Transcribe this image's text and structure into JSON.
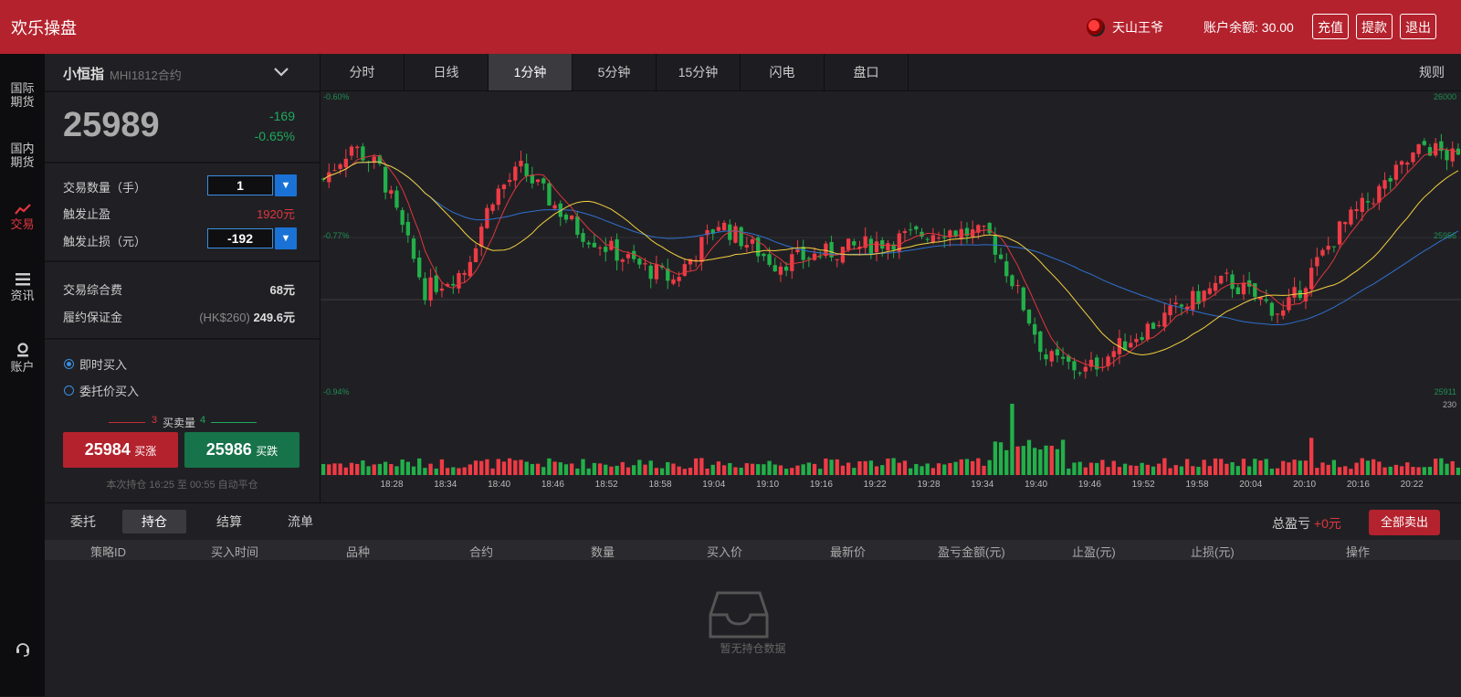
{
  "app": {
    "title": "欢乐操盘"
  },
  "header": {
    "username": "天山王爷",
    "balance_label": "账户余额:",
    "balance_value": "30.00",
    "buttons": {
      "recharge": "充值",
      "withdraw": "提款",
      "logout": "退出"
    }
  },
  "nav": {
    "items": [
      {
        "label_line1": "国际",
        "label_line2": "期货",
        "icon": "globe-icon"
      },
      {
        "label_line1": "国内",
        "label_line2": "期货",
        "icon": "flag-icon"
      },
      {
        "label": "交易",
        "icon": "trend-icon",
        "active": true
      },
      {
        "label": "资讯",
        "icon": "list-icon"
      },
      {
        "label": "账户",
        "icon": "user-icon"
      }
    ],
    "support_icon": "headset-icon"
  },
  "instrument": {
    "name": "小恒指",
    "contract": "MHI1812合约",
    "price": "25989",
    "change": "-169",
    "change_pct": "-0.65%"
  },
  "order": {
    "qty_label": "交易数量（手）",
    "qty_value": "1",
    "take_profit_label": "触发止盈",
    "take_profit_value": "1920元",
    "stop_loss_label": "触发止损（元）",
    "stop_loss_value": "-192",
    "fee_label": "交易综合费",
    "fee_value": "68元",
    "margin_label": "履约保证金",
    "margin_hk": "(HK$260)",
    "margin_value": "249.6元",
    "radio_instant": "即时买入",
    "radio_limit": "委托价买入",
    "depth_left": "3",
    "depth_label": "买卖量",
    "depth_right": "4",
    "buy_up_price": "25984",
    "buy_up_label": "买涨",
    "buy_down_price": "25986",
    "buy_down_label": "买跌",
    "hold_note": "本次持仓 16:25 至 00:55 自动平仓"
  },
  "chart_tabs": [
    "分时",
    "日线",
    "1分钟",
    "5分钟",
    "15分钟",
    "闪电",
    "盘口"
  ],
  "chart_tab_active": "1分钟",
  "rules_label": "规则",
  "chart_labels": {
    "top_left": "-0.60%",
    "mid_left": "-0.77%",
    "bottom_left": "-0.94%",
    "top_right": "26000",
    "mid_right": "25956",
    "bottom_right": "25911",
    "volume_max": "230"
  },
  "chart_data": {
    "type": "candlestick",
    "x_ticks": [
      "18:28",
      "18:34",
      "18:40",
      "18:46",
      "18:52",
      "18:58",
      "19:04",
      "19:10",
      "19:16",
      "19:22",
      "19:28",
      "19:34",
      "19:40",
      "19:46",
      "19:52",
      "19:58",
      "20:04",
      "20:10",
      "20:16",
      "20:22"
    ],
    "ylim": [
      25911,
      26000
    ],
    "y_ticks": [
      26000,
      25956,
      25911
    ],
    "volume_ylim": [
      0,
      230
    ],
    "colors": {
      "up": "#ef3b45",
      "down": "#22b04a",
      "ma1": "#e0363d",
      "ma2": "#f4d03f",
      "ma3": "#2f6fcf"
    }
  },
  "bottom": {
    "tabs": [
      "委托",
      "持仓",
      "结算",
      "流单"
    ],
    "active_tab": "持仓",
    "pnl_label": "总盈亏",
    "pnl_value": "+0元",
    "sell_all": "全部卖出",
    "columns": [
      "策略ID",
      "买入时间",
      "品种",
      "合约",
      "数量",
      "买入价",
      "最新价",
      "盈亏金额(元)",
      "止盈(元)",
      "止损(元)",
      "操作"
    ],
    "empty_text": "暂无持仓数据"
  }
}
